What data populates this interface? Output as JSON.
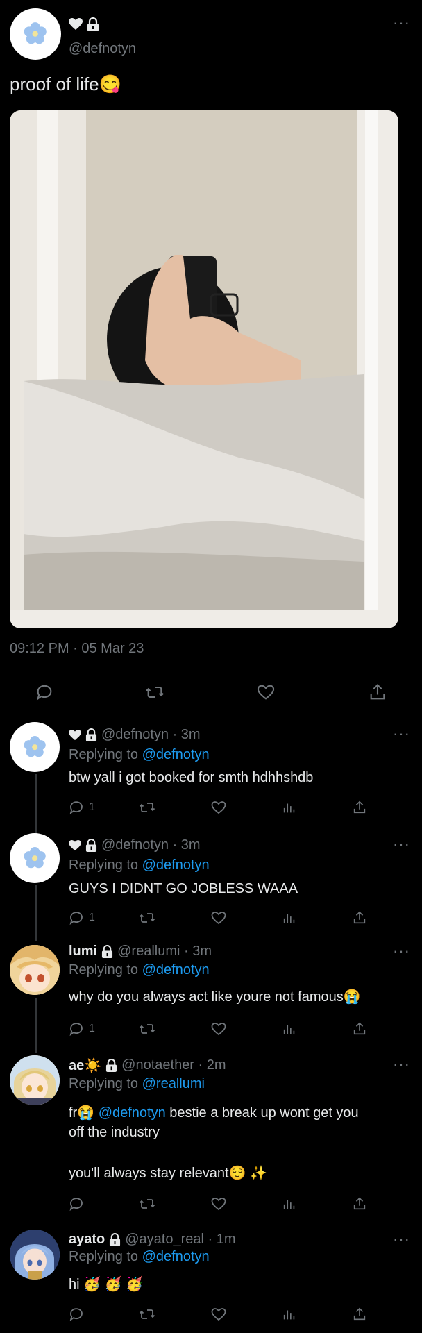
{
  "main_tweet": {
    "handle": "@defnotyn",
    "text": "proof of life😋",
    "timestamp": "09:12 PM · 05 Mar 23",
    "icons": [
      "more-icon",
      "heart-icon",
      "lock-icon",
      "reply-icon",
      "retweet-icon",
      "like-icon",
      "share-icon"
    ]
  },
  "replies": [
    {
      "name": "",
      "handle": "@defnotyn · 3m",
      "replying_label": "Replying to ",
      "replying_to": "@defnotyn",
      "text": "btw yall i got booked for smth hdhhshdb",
      "reply_count": "1"
    },
    {
      "name": "",
      "handle": "@defnotyn · 3m",
      "replying_label": "Replying to ",
      "replying_to": "@defnotyn",
      "text": "GUYS I DIDNT GO JOBLESS WAAA",
      "reply_count": "1"
    },
    {
      "name": "lumi",
      "handle": "@reallumi · 3m",
      "replying_label": "Replying to ",
      "replying_to": "@defnotyn",
      "text": "why do you always act like youre not famous😭",
      "reply_count": "1"
    },
    {
      "name": "ae☀️",
      "handle": "@notaether · 2m",
      "replying_label": "Replying to ",
      "replying_to": "@reallumi",
      "text_prefix": "fr😭",
      "mention": "@defnotyn",
      "text_line1_rest": " bestie a break up wont get you",
      "text_line2": "off the industry",
      "text_line3": "you'll always stay relevant😌 ✨",
      "reply_count": ""
    },
    {
      "name": "ayato",
      "handle": "@ayato_real · 1m",
      "replying_label": "Replying to ",
      "replying_to": "@defnotyn",
      "text": "hi 🥳 🥳 🥳",
      "reply_count": ""
    }
  ],
  "colors": {
    "background": "#000000",
    "text": "#e7e9ea",
    "muted": "#71767b",
    "link": "#1d9bf0",
    "divider": "#2f3336"
  }
}
